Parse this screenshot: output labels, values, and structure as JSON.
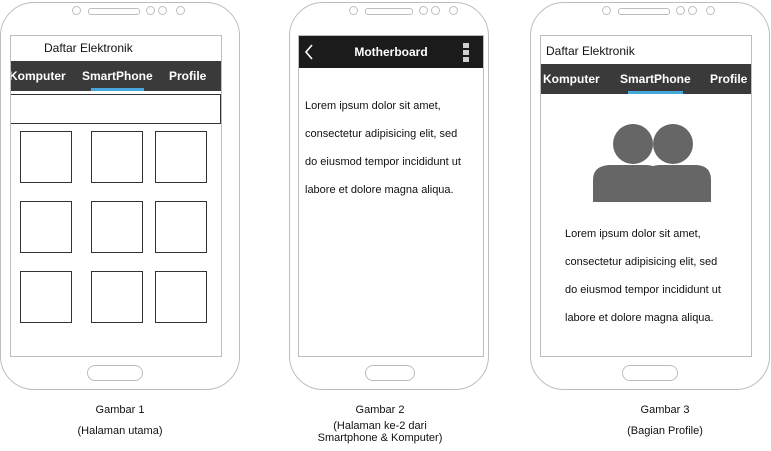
{
  "screen1": {
    "app_title": "Daftar Elektronik",
    "tabs": [
      {
        "label": "Komputer"
      },
      {
        "label": "SmartPhone",
        "active": true
      },
      {
        "label": "Profile"
      }
    ],
    "caption": {
      "line1": "Gambar 1",
      "line2": "(Halaman utama)"
    }
  },
  "screen2": {
    "header_title": "Motherboard",
    "icons": [
      "chevron-left-icon",
      "more-vertical-icon"
    ],
    "body_lines": [
      "Lorem ipsum dolor sit amet,",
      "consectetur adipisicing elit, sed",
      "do eiusmod tempor incididunt ut",
      "labore et dolore magna aliqua."
    ],
    "caption": {
      "line1": "Gambar 2",
      "line2": "(Halaman ke-2 dari",
      "line3": "Smartphone & Komputer)"
    }
  },
  "screen3": {
    "app_title": "Daftar Elektronik",
    "tabs": [
      {
        "label": "Komputer"
      },
      {
        "label": "SmartPhone",
        "active": true
      },
      {
        "label": "Profile"
      }
    ],
    "icon": "users-icon",
    "body_lines": [
      "Lorem ipsum dolor sit amet,",
      "consectetur adipisicing elit, sed",
      "do eiusmod tempor incididunt ut",
      "labore et dolore magna aliqua."
    ],
    "caption": {
      "line1": "Gambar 3",
      "line2": "(Bagian Profile)"
    }
  },
  "colors": {
    "navbar": "#3a3a3a",
    "header_dark": "#1b1b1b",
    "tab_indicator": "#45a8dc",
    "avatar": "#666666",
    "outline": "#bdbdbd"
  }
}
